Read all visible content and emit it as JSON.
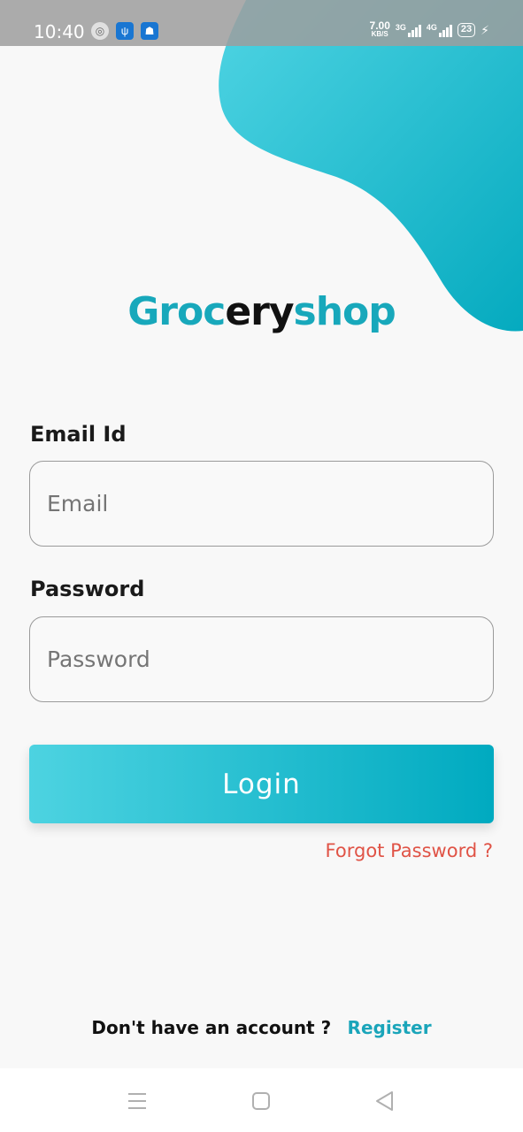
{
  "status_bar": {
    "time": "10:40",
    "net_speed_value": "7.00",
    "net_speed_unit": "KB/S",
    "sim1_label": "3G",
    "sim2_label": "4G",
    "battery": "23"
  },
  "logo": {
    "part1": "Groc",
    "part2": "ery",
    "part3": "shop"
  },
  "form": {
    "email_label": "Email Id",
    "email_placeholder": "Email",
    "password_label": "Password",
    "password_placeholder": "Password",
    "login_label": "Login",
    "forgot_label": "Forgot Password ?"
  },
  "footer": {
    "question": "Don't have an account ?",
    "register_label": "Register"
  },
  "colors": {
    "accent": "#18a8bb",
    "button_gradient_start": "#4dd3e1",
    "button_gradient_end": "#00aac0",
    "forgot": "#e05346"
  }
}
